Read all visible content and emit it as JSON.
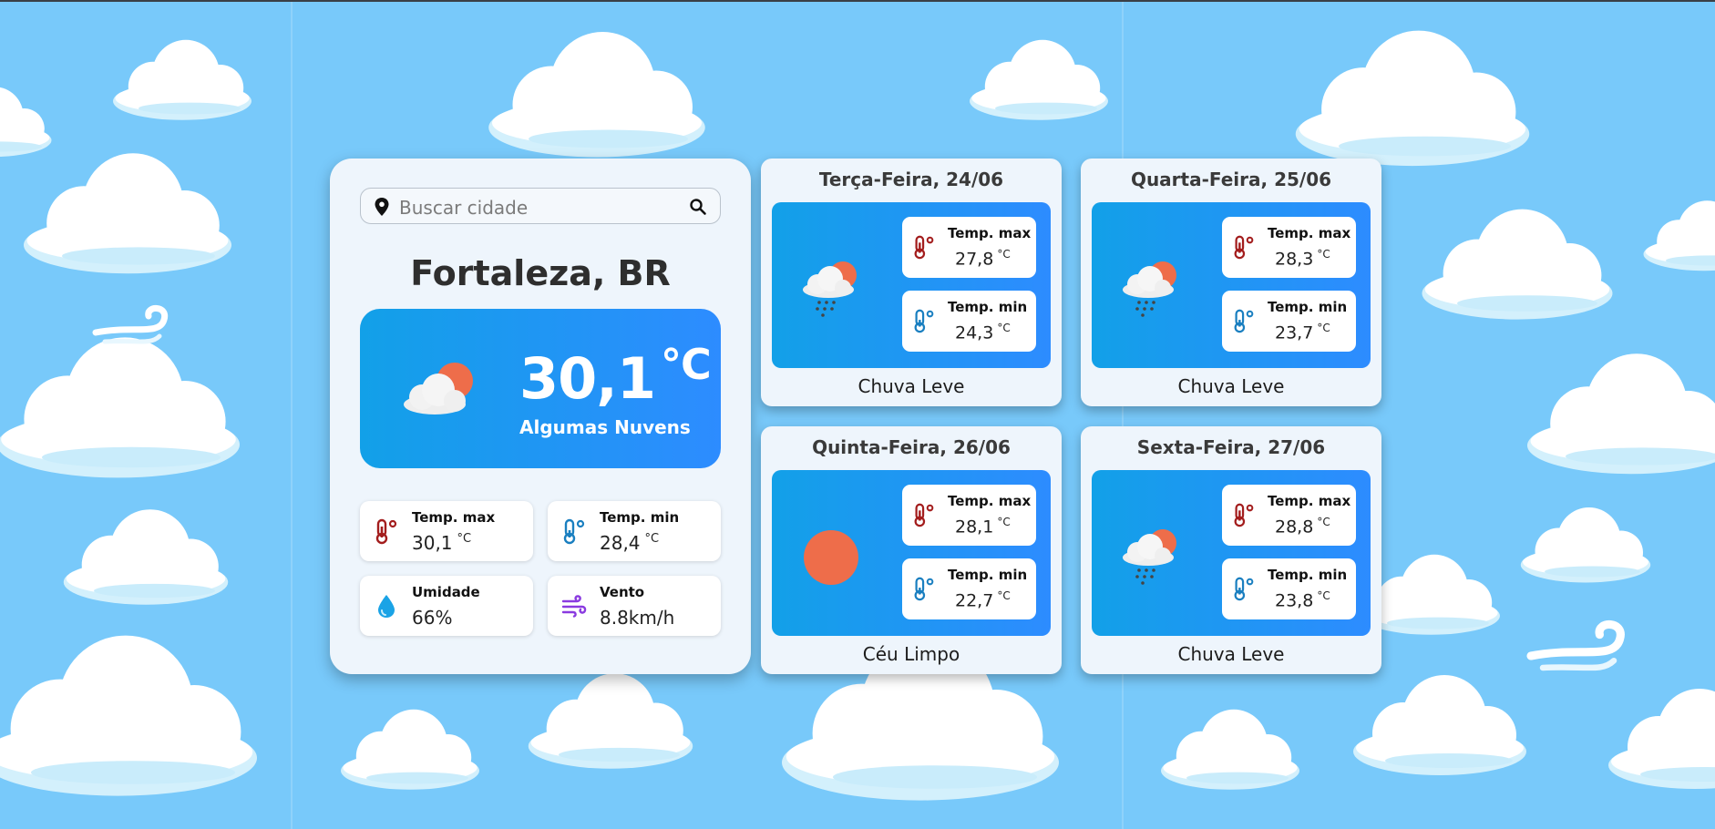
{
  "search": {
    "placeholder": "Buscar cidade"
  },
  "current": {
    "city": "Fortaleza, BR",
    "temp": "30,1",
    "temp_unit": "°C",
    "description": "Algumas Nuvens",
    "stats": {
      "max": {
        "label": "Temp. max",
        "value": "30,1",
        "unit": "°C"
      },
      "min": {
        "label": "Temp. min",
        "value": "28,4",
        "unit": "°C"
      },
      "humidity": {
        "label": "Umidade",
        "value": "66%"
      },
      "wind": {
        "label": "Vento",
        "value": "8.8km/h"
      }
    }
  },
  "forecast": [
    {
      "date": "Terça-Feira, 24/06",
      "icon": "rain-cloud-sun-icon",
      "max_label": "Temp. max",
      "max": "27,8",
      "min_label": "Temp. min",
      "min": "24,3",
      "unit": "°C",
      "condition": "Chuva Leve"
    },
    {
      "date": "Quarta-Feira, 25/06",
      "icon": "rain-cloud-sun-icon",
      "max_label": "Temp. max",
      "max": "28,3",
      "min_label": "Temp. min",
      "min": "23,7",
      "unit": "°C",
      "condition": "Chuva Leve"
    },
    {
      "date": "Quinta-Feira, 26/06",
      "icon": "sun-icon",
      "max_label": "Temp. max",
      "max": "28,1",
      "min_label": "Temp. min",
      "min": "22,7",
      "unit": "°C",
      "condition": "Céu Limpo"
    },
    {
      "date": "Sexta-Feira, 27/06",
      "icon": "rain-cloud-sun-icon",
      "max_label": "Temp. max",
      "max": "28,8",
      "min_label": "Temp. min",
      "min": "23,8",
      "unit": "°C",
      "condition": "Chuva Leve"
    }
  ],
  "colors": {
    "sky": "#78c9fa",
    "panel_gradient_start": "#12a0e8",
    "panel_gradient_end": "#2d8cff",
    "max_icon": "#a31d1d",
    "min_icon": "#1a7fc0",
    "sun": "#ee6d4a"
  }
}
